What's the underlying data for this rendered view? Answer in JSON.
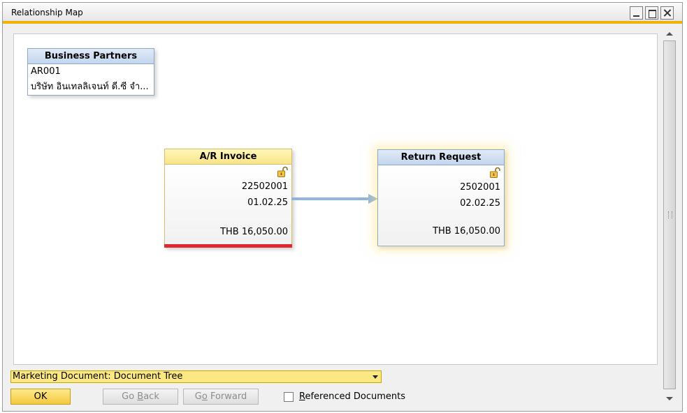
{
  "window": {
    "title": "Relationship Map"
  },
  "nodes": {
    "business_partner": {
      "header": "Business Partners",
      "code": "AR001",
      "name": "บริษัท อินเทลลิเจนท์ ดี.ซี จำ..."
    },
    "ar_invoice": {
      "header": "A/R Invoice",
      "doc_number": "22502001",
      "date": "01.02.25",
      "total": "THB 16,050.00",
      "icon": "open-lock-icon",
      "status_color": "#e0282d"
    },
    "return_request": {
      "header": "Return Request",
      "doc_number": "2502001",
      "date": "02.02.25",
      "total": "THB 16,050.00",
      "icon": "open-lock-icon"
    }
  },
  "footer": {
    "view_select": "Marketing Document: Document Tree",
    "ok_label": "OK",
    "go_back_pre": "Go ",
    "go_back_key": "B",
    "go_back_post": "ack",
    "go_forward_pre": "G",
    "go_forward_key": "o",
    "go_forward_post": " Forward",
    "referenced_docs_label": "Referenced Documents",
    "referenced_docs_checked": false
  },
  "colors": {
    "accent": "#f0b400",
    "invoice_header": "#f8e48a",
    "link_arrow": "#8fb4de"
  }
}
